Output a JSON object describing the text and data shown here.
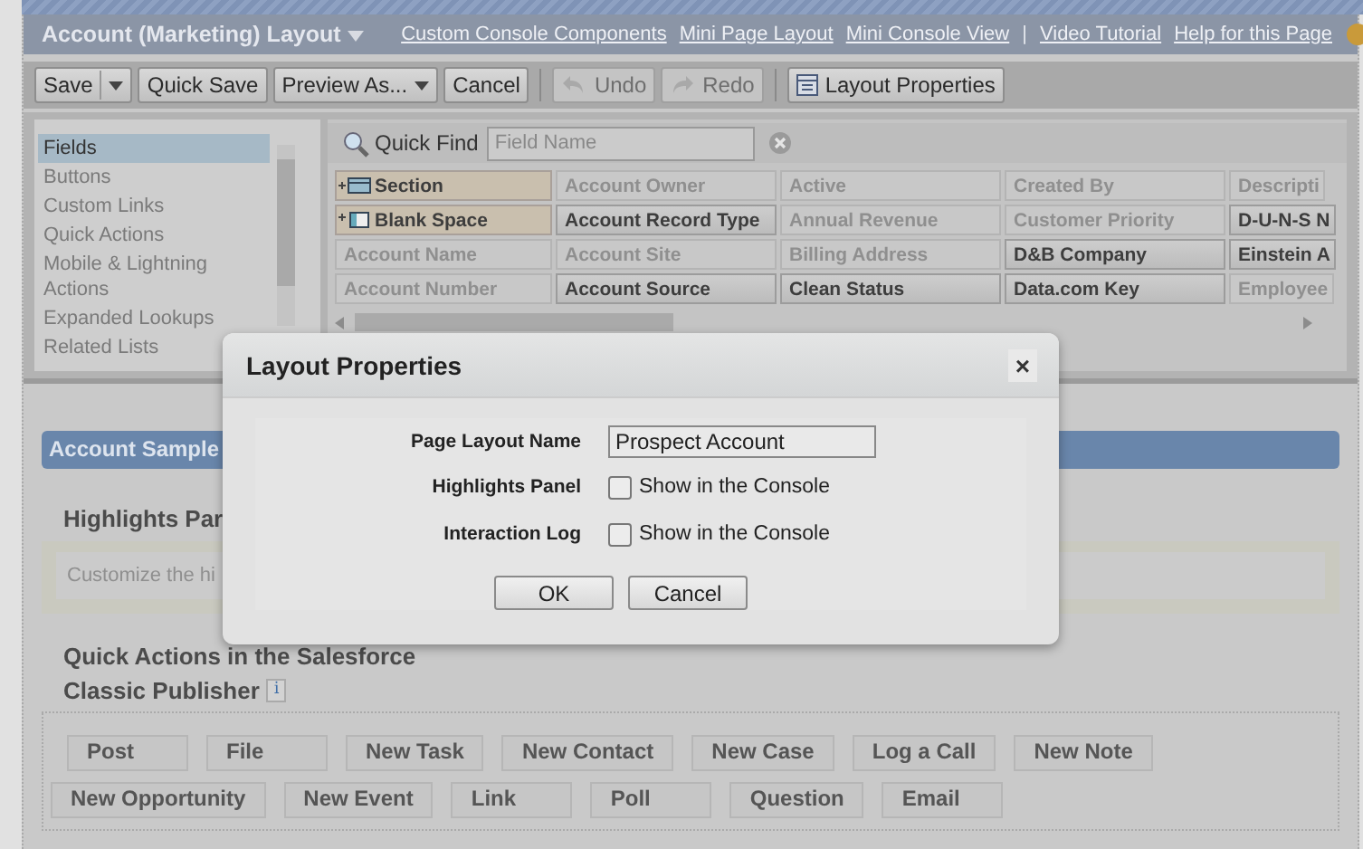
{
  "header": {
    "title": "Account (Marketing) Layout",
    "separator": "|",
    "links": [
      "Custom Console Components",
      "Mini Page Layout",
      "Mini Console View",
      "Video Tutorial",
      "Help for this Page"
    ]
  },
  "toolbar": [
    {
      "label": "Save",
      "kind": "split",
      "disabled": false
    },
    {
      "label": "Quick Save",
      "kind": "plain",
      "disabled": false
    },
    {
      "label": "Preview As...",
      "kind": "dropdown",
      "disabled": false
    },
    {
      "label": "Cancel",
      "kind": "plain",
      "disabled": false
    },
    {
      "label": "Undo",
      "kind": "undo",
      "disabled": true
    },
    {
      "label": "Redo",
      "kind": "redo",
      "disabled": true
    },
    {
      "label": "Layout Properties",
      "kind": "properties",
      "disabled": false
    }
  ],
  "palette": {
    "categories": [
      {
        "label": "Fields",
        "selected": true
      },
      {
        "label": "Buttons",
        "selected": false
      },
      {
        "label": "Custom Links",
        "selected": false
      },
      {
        "label": "Quick Actions",
        "selected": false
      },
      {
        "label": "Mobile & Lightning Actions",
        "selected": false
      },
      {
        "label": "Expanded Lookups",
        "selected": false
      },
      {
        "label": "Related Lists",
        "selected": false
      }
    ],
    "quick_find": {
      "label": "Quick Find",
      "placeholder": "Field Name"
    },
    "fields": [
      [
        {
          "label": "Section",
          "kind": "section"
        },
        {
          "label": "Account Owner",
          "kind": "field",
          "in_use": true
        },
        {
          "label": "Active",
          "kind": "field",
          "in_use": true
        },
        {
          "label": "Created By",
          "kind": "field",
          "in_use": true
        },
        {
          "label": "Descripti",
          "kind": "field",
          "in_use": true
        }
      ],
      [
        {
          "label": "Blank Space",
          "kind": "blank"
        },
        {
          "label": "Account Record Type",
          "kind": "field",
          "in_use": false
        },
        {
          "label": "Annual Revenue",
          "kind": "field",
          "in_use": true
        },
        {
          "label": "Customer Priority",
          "kind": "field",
          "in_use": true
        },
        {
          "label": "D-U-N-S N",
          "kind": "field",
          "in_use": false
        }
      ],
      [
        {
          "label": "Account Name",
          "kind": "field",
          "in_use": true
        },
        {
          "label": "Account Site",
          "kind": "field",
          "in_use": true
        },
        {
          "label": "Billing Address",
          "kind": "field",
          "in_use": true
        },
        {
          "label": "D&B Company",
          "kind": "field",
          "in_use": false
        },
        {
          "label": "Einstein A",
          "kind": "field",
          "in_use": false
        }
      ],
      [
        {
          "label": "Account Number",
          "kind": "field",
          "in_use": true
        },
        {
          "label": "Account Source",
          "kind": "field",
          "in_use": false
        },
        {
          "label": "Clean Status",
          "kind": "field",
          "in_use": false
        },
        {
          "label": "Data.com Key",
          "kind": "field",
          "in_use": false
        },
        {
          "label": "Employee",
          "kind": "field",
          "in_use": true
        }
      ]
    ]
  },
  "layout": {
    "section_title": "Account Sample",
    "highlights_heading": "Highlights Par",
    "highlights_hint": "Customize the hi",
    "quick_actions_heading": [
      "Quick Actions in the Salesforce",
      "Classic Publisher"
    ],
    "info_icon": "i",
    "actions": [
      [
        "Post",
        "File",
        "New Task",
        "New Contact",
        "New Case",
        "Log a Call",
        "New Note"
      ],
      [
        "New Opportunity",
        "New Event",
        "Link",
        "Poll",
        "Question",
        "Email"
      ]
    ]
  },
  "dialog": {
    "title": "Layout Properties",
    "close": "×",
    "name_label": "Page Layout Name",
    "name_value": "Prospect Account",
    "options": [
      {
        "label": "Highlights Panel",
        "text": "Show in the Console",
        "checked": false
      },
      {
        "label": "Interaction Log",
        "text": "Show in the Console",
        "checked": false
      }
    ],
    "buttons": [
      "OK",
      "Cancel"
    ]
  }
}
